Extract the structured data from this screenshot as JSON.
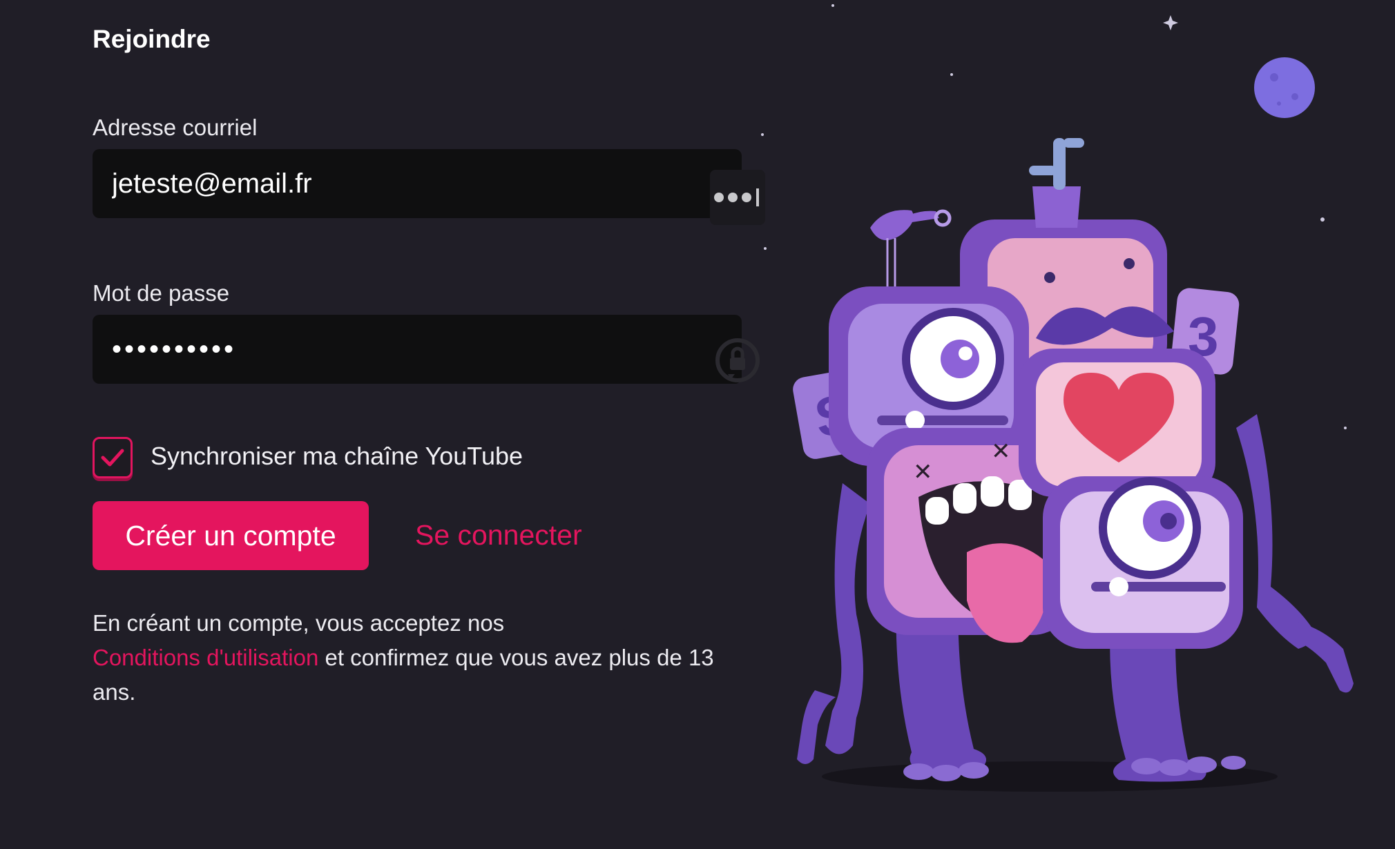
{
  "form": {
    "title": "Rejoindre",
    "email_label": "Adresse courriel",
    "email_value": "jeteste@email.fr",
    "password_label": "Mot de passe",
    "password_value": "••••••••••",
    "sync_label": "Synchroniser ma chaîne YouTube",
    "sync_checked": true,
    "create_button": "Créer un compte",
    "login_link": "Se connecter",
    "legal_prefix": "En créant un compte, vous acceptez nos",
    "terms_link": "Conditions d'utilisation",
    "legal_suffix": " et confirmez que vous avez plus de 13 ans."
  },
  "illustration": {
    "description_icon": "purple-monster-tv-stack-illustration",
    "signs": [
      "3",
      "S"
    ]
  },
  "colors": {
    "background": "#201e27",
    "input_bg": "#0f0f10",
    "accent": "#e4155e",
    "monster_purple": "#7a5ac8"
  }
}
